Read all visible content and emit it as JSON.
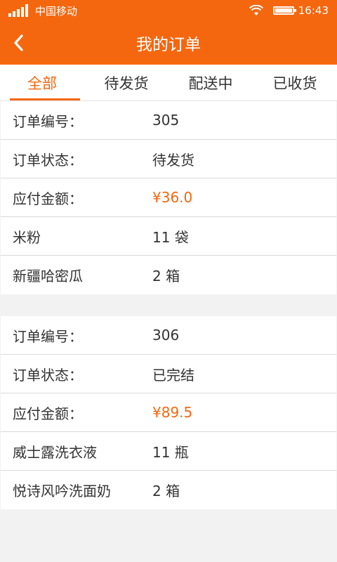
{
  "status": {
    "carrier": "中国移动",
    "time": "16:43"
  },
  "header": {
    "title": "我的订单"
  },
  "tabs": [
    {
      "label": "全部",
      "active": true
    },
    {
      "label": "待发货",
      "active": false
    },
    {
      "label": "配送中",
      "active": false
    },
    {
      "label": "已收货",
      "active": false
    }
  ],
  "orders": [
    {
      "rows": [
        {
          "label": "订单编号：",
          "value": "305"
        },
        {
          "label": "订单状态：",
          "value": "待发货"
        },
        {
          "label": "应付金额：",
          "value": "¥36.0"
        },
        {
          "label": "米粉",
          "value": "11 袋"
        },
        {
          "label": "新疆哈密瓜",
          "value": "2 箱"
        }
      ]
    },
    {
      "rows": [
        {
          "label": "订单编号：",
          "value": "306"
        },
        {
          "label": "订单状态：",
          "value": "已完结"
        },
        {
          "label": "应付金额：",
          "value": "¥89.5"
        },
        {
          "label": "威士露洗衣液",
          "value": "11 瓶"
        },
        {
          "label": "悦诗风吟洗面奶",
          "value": "2 箱"
        }
      ]
    }
  ],
  "colors": {
    "accent": "#f5670f"
  }
}
